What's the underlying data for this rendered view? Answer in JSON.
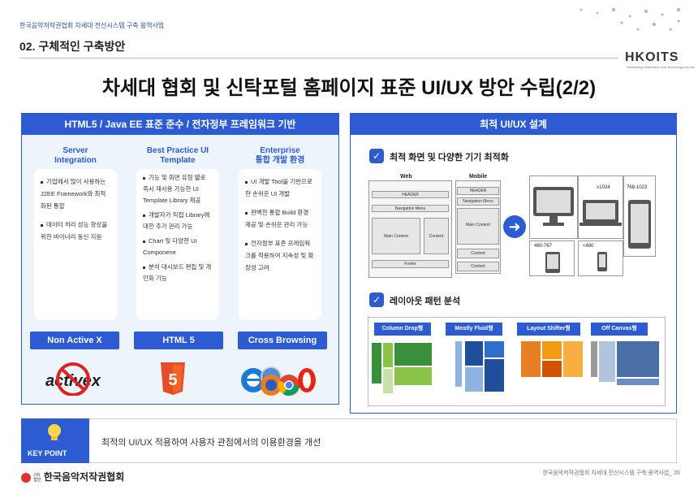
{
  "header": {
    "project": "한국음악저작권협회 차세대 전산시스템 구축 용역사업",
    "section": "02. 구체적인 구축방안",
    "logo": "HKOITS",
    "logo_sub": "Networking Information and Technology service"
  },
  "title": "차세대 협회 및 신탁포털 홈페이지 표준 UI/UX 방안 수립(2/2)",
  "left": {
    "heading": "HTML5 / Java EE 표준 준수 / 전자정부 프레임워크 기반",
    "columns": [
      {
        "title_line1": "Server",
        "title_line2": "Integration",
        "bullets": [
          "기업에서 많이 사용하는 J2EE Framework와 최적화된 통합",
          "데이터 처리 성능 향상을 위한 바이너리 동신 지원"
        ]
      },
      {
        "title_line1": "Best Practice UI",
        "title_line2": "Template",
        "bullets": [
          "기능 및 화면 유형 별로 즉시 재사용 가능한 UI Template Library 제공",
          "개발자가 직접 Library에 대한 추가 관리 가능",
          "Chart 및 다양한 UI Componene",
          "분석 대시보드 편집 및 개인화 기능"
        ]
      },
      {
        "title_line1": "Enterprise",
        "title_line2": "통합 개발 환경",
        "bullets": [
          "UI 개발 Tool을 기반으로 한 손쉬운 UI 개발",
          "완벽한 통합 Build 환경 제공 및 손쉬운 관리 가능",
          "전자정부 표준 프레임워크를 적용하여 지속성 및 확장성 고려"
        ]
      }
    ],
    "buttons": [
      "Non Active X",
      "HTML 5",
      "Cross Browsing"
    ],
    "activex_logo": "activex",
    "html5_logo": "5"
  },
  "right": {
    "heading": "최적 UI/UX 설계",
    "sec1": "최적 화면 및 다양한 기기 최적화",
    "sec2": "레이아웃 패턴 분석",
    "web_label": "Web",
    "mobile_label": "Mobile",
    "wire_web": {
      "header": "HEADER",
      "nav": "Navigation Menu",
      "main": "Main Content",
      "content": "Content",
      "footer": "Footer"
    },
    "wire_mobile": {
      "header": "HEADER",
      "nav": "Navigation Menu",
      "main": "Main Content",
      "content1": "Content",
      "content2": "Content"
    },
    "devices": {
      "d1": "≥1024",
      "d2": "768-1023",
      "d3": "480-767",
      "d4": "<480"
    },
    "layouts": [
      "Column Drop형",
      "Mostly Fluid형",
      "Layout Shifter형",
      "Off Canvas형"
    ]
  },
  "keypoint": {
    "label": "KEY POINT",
    "message": "최적의 UI/UX 적용하여 사용자 관점에서의 이용환경을 개선"
  },
  "footer": {
    "org": "한국음악저작권협회",
    "org_small_1": "(사)",
    "org_small_2": "법인",
    "page": "한국음악저작권협회 차세대 전산시스템 구축 용역사업_ 26"
  },
  "colors": {
    "accent": "#2d5bd1",
    "brand_red": "#e0342a"
  }
}
